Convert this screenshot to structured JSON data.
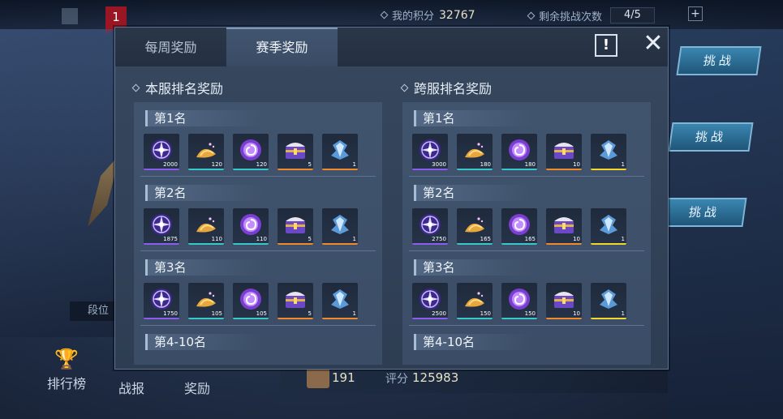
{
  "background": {
    "rank_badge": "1",
    "my_points_label": "我的积分",
    "my_points_value": "32767",
    "remaining_label": "剩余挑战次数",
    "remaining_value": "4/5",
    "plus": "+",
    "challenge_label": "挑战",
    "segment_label": "段位",
    "nav": [
      {
        "label": "排行榜",
        "icon": "trophy-icon"
      },
      {
        "label": "战报"
      },
      {
        "label": "奖励"
      }
    ],
    "bottom_rank": "191",
    "score_label": "评分",
    "score_value": "125983"
  },
  "modal": {
    "tabs": [
      {
        "label": "每周奖励",
        "active": false
      },
      {
        "label": "赛季奖励",
        "active": true
      }
    ],
    "info_label": "!",
    "close_label": "✕",
    "sections": [
      {
        "title": "本服排名奖励",
        "ranks": [
          {
            "label": "第1名",
            "items": [
              {
                "icon": "purple-orb-icon",
                "qty": "2000",
                "bar": "#8a5cf0"
              },
              {
                "icon": "gold-dust-icon",
                "qty": "120",
                "bar": "#37c9c9"
              },
              {
                "icon": "spiral-orb-icon",
                "qty": "120",
                "bar": "#37c9c9"
              },
              {
                "icon": "treasure-chest-icon",
                "qty": "5",
                "bar": "#f08a2a"
              },
              {
                "icon": "crystal-emblem-icon",
                "qty": "1",
                "bar": "#f08a2a"
              }
            ]
          },
          {
            "label": "第2名",
            "items": [
              {
                "icon": "purple-orb-icon",
                "qty": "1875",
                "bar": "#8a5cf0"
              },
              {
                "icon": "gold-dust-icon",
                "qty": "110",
                "bar": "#37c9c9"
              },
              {
                "icon": "spiral-orb-icon",
                "qty": "110",
                "bar": "#37c9c9"
              },
              {
                "icon": "treasure-chest-icon",
                "qty": "5",
                "bar": "#f08a2a"
              },
              {
                "icon": "crystal-emblem-icon",
                "qty": "1",
                "bar": "#f08a2a"
              }
            ]
          },
          {
            "label": "第3名",
            "items": [
              {
                "icon": "purple-orb-icon",
                "qty": "1750",
                "bar": "#8a5cf0"
              },
              {
                "icon": "gold-dust-icon",
                "qty": "105",
                "bar": "#37c9c9"
              },
              {
                "icon": "spiral-orb-icon",
                "qty": "105",
                "bar": "#37c9c9"
              },
              {
                "icon": "treasure-chest-icon",
                "qty": "5",
                "bar": "#f08a2a"
              },
              {
                "icon": "crystal-emblem-icon",
                "qty": "1",
                "bar": "#f08a2a"
              }
            ]
          },
          {
            "label": "第4-10名",
            "items": []
          }
        ]
      },
      {
        "title": "跨服排名奖励",
        "ranks": [
          {
            "label": "第1名",
            "items": [
              {
                "icon": "purple-orb-icon",
                "qty": "3000",
                "bar": "#8a5cf0"
              },
              {
                "icon": "gold-dust-icon",
                "qty": "180",
                "bar": "#37c9c9"
              },
              {
                "icon": "spiral-orb-icon",
                "qty": "180",
                "bar": "#37c9c9"
              },
              {
                "icon": "treasure-chest-icon",
                "qty": "10",
                "bar": "#f08a2a"
              },
              {
                "icon": "crystal-emblem-icon",
                "qty": "1",
                "bar": "#f2d62a"
              }
            ]
          },
          {
            "label": "第2名",
            "items": [
              {
                "icon": "purple-orb-icon",
                "qty": "2750",
                "bar": "#8a5cf0"
              },
              {
                "icon": "gold-dust-icon",
                "qty": "165",
                "bar": "#37c9c9"
              },
              {
                "icon": "spiral-orb-icon",
                "qty": "165",
                "bar": "#37c9c9"
              },
              {
                "icon": "treasure-chest-icon",
                "qty": "10",
                "bar": "#f08a2a"
              },
              {
                "icon": "crystal-emblem-icon",
                "qty": "1",
                "bar": "#f2d62a"
              }
            ]
          },
          {
            "label": "第3名",
            "items": [
              {
                "icon": "purple-orb-icon",
                "qty": "2500",
                "bar": "#8a5cf0"
              },
              {
                "icon": "gold-dust-icon",
                "qty": "150",
                "bar": "#37c9c9"
              },
              {
                "icon": "spiral-orb-icon",
                "qty": "150",
                "bar": "#37c9c9"
              },
              {
                "icon": "treasure-chest-icon",
                "qty": "10",
                "bar": "#f08a2a"
              },
              {
                "icon": "crystal-emblem-icon",
                "qty": "1",
                "bar": "#f2d62a"
              }
            ]
          },
          {
            "label": "第4-10名",
            "items": []
          }
        ]
      }
    ]
  }
}
